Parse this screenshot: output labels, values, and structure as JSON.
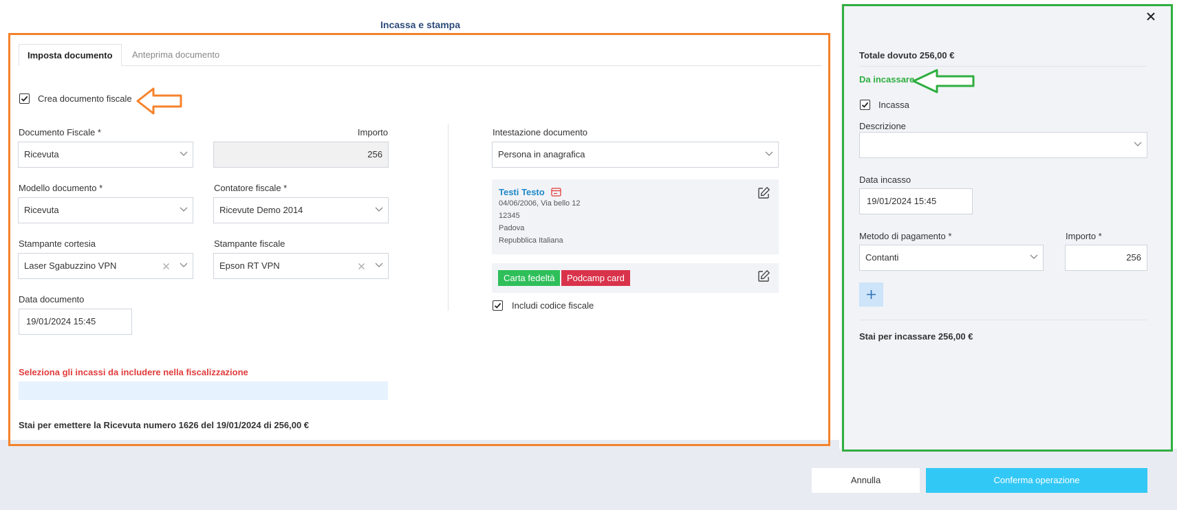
{
  "modal": {
    "title": "Incassa e stampa"
  },
  "tabs": [
    {
      "label": "Imposta documento"
    },
    {
      "label": "Anteprima documento"
    }
  ],
  "left": {
    "crea_documento_label": "Crea documento fiscale",
    "documento_fiscale": {
      "label": "Documento Fiscale *",
      "value": "Ricevuta"
    },
    "importo": {
      "label": "Importo",
      "value": "256"
    },
    "modello_documento": {
      "label": "Modello documento *",
      "value": "Ricevuta"
    },
    "contatore_fiscale": {
      "label": "Contatore fiscale *",
      "value": "Ricevute Demo 2014"
    },
    "stampante_cortesia": {
      "label": "Stampante cortesia",
      "value": "Laser Sgabuzzino VPN"
    },
    "stampante_fiscale": {
      "label": "Stampante fiscale",
      "value": "Epson RT VPN"
    },
    "data_documento": {
      "label": "Data documento",
      "value": "19/01/2024 15:45"
    },
    "seleziona_incassi_label": "Seleziona gli incassi da includere nella fiscalizzazione",
    "summary": "Stai per emettere la Ricevuta numero 1626 del 19/01/2024 di 256,00 €"
  },
  "middle": {
    "intestazione": {
      "label": "Intestazione documento",
      "value": "Persona in anagrafica"
    },
    "customer": {
      "name": "Testi Testo",
      "lines": [
        "04/06/2006, Via bello 12",
        "12345",
        "Padova",
        "Repubblica Italiana"
      ]
    },
    "badges": [
      "Carta fedeltà",
      "Podcamp card"
    ],
    "includi_codice_fiscale_label": "Includi codice fiscale"
  },
  "right": {
    "totale": "Totale dovuto 256,00 €",
    "da_incassare": "Da incassare",
    "incassa_label": "Incassa",
    "descrizione": {
      "label": "Descrizione",
      "value": ""
    },
    "data_incasso": {
      "label": "Data incasso",
      "value": "19/01/2024 15:45"
    },
    "metodo_pagamento": {
      "label": "Metodo di pagamento *",
      "value": "Contanti"
    },
    "importo": {
      "label": "Importo *",
      "value": "256"
    },
    "summary": "Stai per incassare 256,00 €"
  },
  "footer": {
    "annulla": "Annulla",
    "conferma": "Conferma operazione"
  },
  "colors": {
    "orange_frame": "#f5822a",
    "green_frame": "#2fae3f",
    "confirm_button": "#32c8f6",
    "badge_green": "#2fbf5a",
    "badge_red": "#d9334b",
    "error_red": "#e23b3b"
  }
}
